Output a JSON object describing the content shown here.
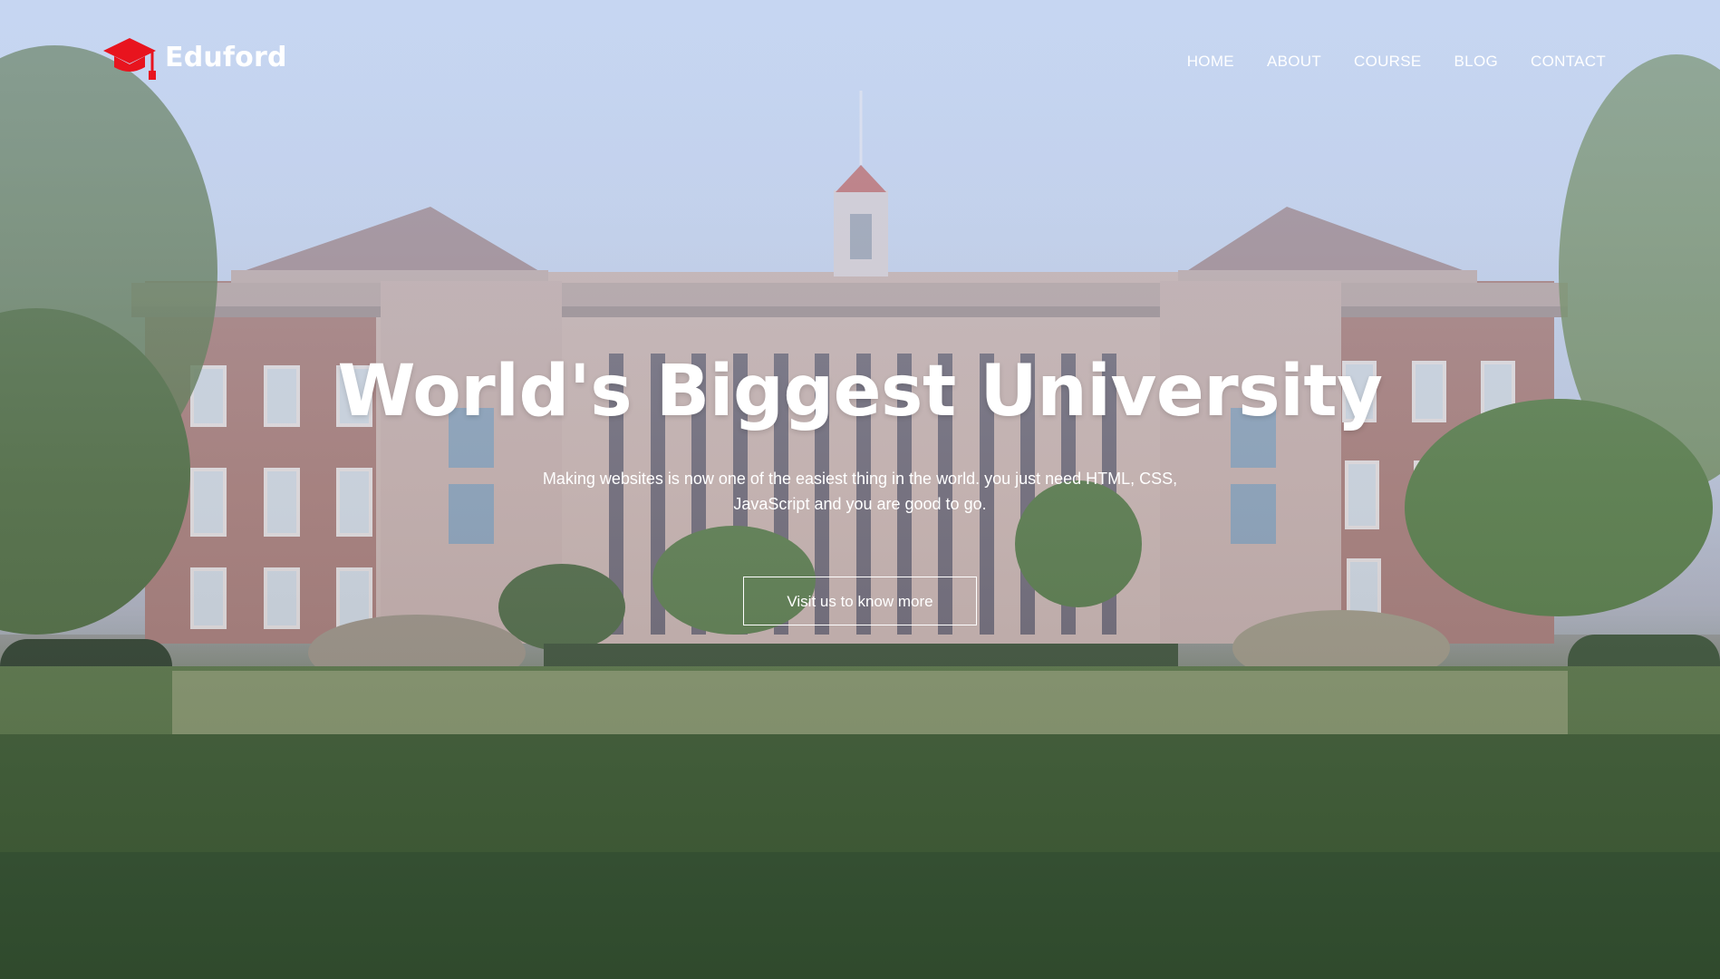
{
  "brand": {
    "name": "Eduford",
    "accent_color": "#e8141e",
    "icon": "graduation-cap-icon"
  },
  "nav": {
    "items": [
      {
        "label": "HOME"
      },
      {
        "label": "ABOUT"
      },
      {
        "label": "COURSE"
      },
      {
        "label": "BLOG"
      },
      {
        "label": "CONTACT"
      }
    ]
  },
  "hero": {
    "title": "World's Biggest University",
    "subtitle": "Making websites is now one of the easiest thing in the world. you just need HTML, CSS, JavaScript and you are good to go.",
    "cta_label": "Visit us to know more"
  }
}
